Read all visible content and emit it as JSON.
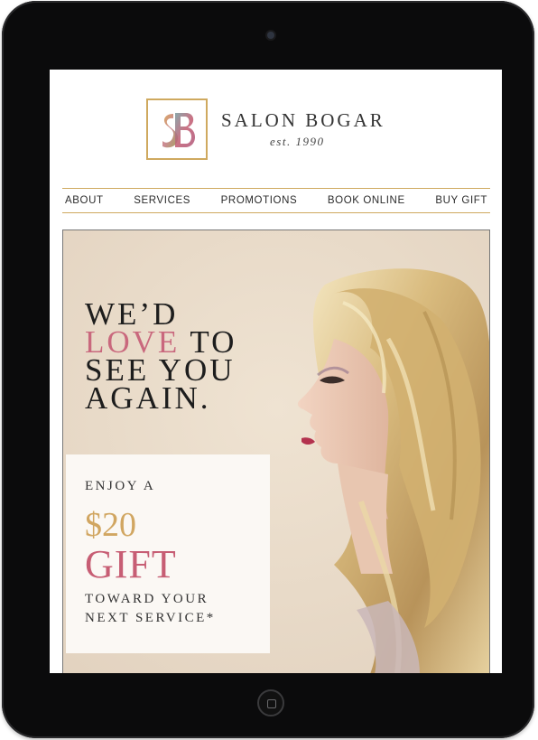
{
  "brand": {
    "name": "SALON BOGAR",
    "established": "est. 1990",
    "logo_monogram": "SB",
    "accent_gold": "#cfa95f",
    "accent_pink": "#c9687d"
  },
  "nav": {
    "items": [
      {
        "label": "ABOUT"
      },
      {
        "label": "SERVICES"
      },
      {
        "label": "PROMOTIONS"
      },
      {
        "label": "BOOK ONLINE"
      },
      {
        "label": "BUY GIFT"
      }
    ]
  },
  "hero": {
    "headline_line1": "WE’D",
    "headline_love": "LOVE",
    "headline_line2_rest": " TO",
    "headline_line3": "SEE YOU",
    "headline_line4": "AGAIN."
  },
  "offer": {
    "intro": "ENJOY A",
    "amount": "$20",
    "gift": "GIFT",
    "desc_line1": "TOWARD YOUR",
    "desc_line2": "NEXT SERVICE*"
  },
  "device": {
    "home_button_icon": "home-button-icon",
    "camera_icon": "front-camera-icon"
  }
}
